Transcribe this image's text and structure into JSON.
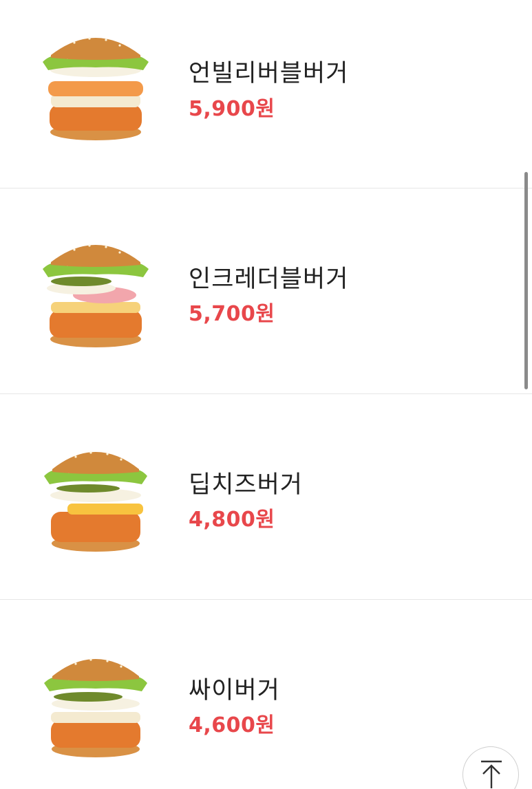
{
  "menu": {
    "items": [
      {
        "name": "언빌리버블버거",
        "price": "5,900원",
        "image": "burger-photo"
      },
      {
        "name": "인크레더블버거",
        "price": "5,700원",
        "image": "burger-photo"
      },
      {
        "name": "딥치즈버거",
        "price": "4,800원",
        "image": "burger-photo"
      },
      {
        "name": "싸이버거",
        "price": "4,600원",
        "image": "burger-photo"
      }
    ]
  },
  "scroll_top_button": {
    "icon": "arrow-up-icon"
  },
  "colors": {
    "price": "#e8474b",
    "name": "#222222",
    "divider": "#e6e6e6",
    "scrollbar": "#8a8a8a"
  }
}
